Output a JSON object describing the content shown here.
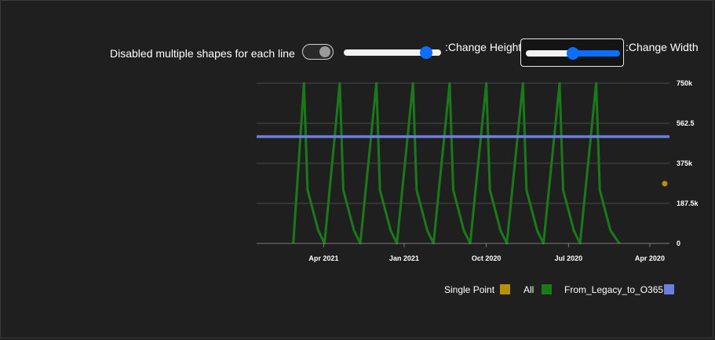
{
  "controls": {
    "toggle_label": "Disabled multiple shapes for each line",
    "height_label": ":Change Height",
    "width_label": ":Change Width",
    "height_value": 0.85,
    "width_value": 0.5
  },
  "colors": {
    "all": "#1a7a1a",
    "from_legacy": "#6c7ee1",
    "single_point": "#b8900a",
    "grid": "#4a4a4a"
  },
  "chart_data": {
    "type": "line",
    "x_axis": {
      "reversed": true,
      "range": [
        "2020-03-10",
        "2021-06-15"
      ],
      "ticks": [
        {
          "date": "2021-04-01",
          "label": "Apr 2021"
        },
        {
          "date": "2021-01-01",
          "label": "Jan 2021"
        },
        {
          "date": "2020-10-01",
          "label": "Oct 2020"
        },
        {
          "date": "2020-07-01",
          "label": "Jul 2020"
        },
        {
          "date": "2020-04-01",
          "label": "Apr 2020"
        }
      ]
    },
    "y_axis": {
      "position": "right",
      "range": [
        0,
        750000
      ],
      "ticks": [
        {
          "value": 0,
          "label": "0"
        },
        {
          "value": 187500,
          "label": "187.5k"
        },
        {
          "value": 375000,
          "label": "375k"
        },
        {
          "value": 562500,
          "label": "562.5"
        },
        {
          "value": 750000,
          "label": "750k"
        }
      ]
    },
    "grid": true,
    "legend_position": "bottom-right",
    "series": [
      {
        "name": "All",
        "points": [
          [
            "2021-05-05",
            0
          ],
          [
            "2021-04-23",
            750000
          ],
          [
            "2021-04-19",
            250000
          ],
          [
            "2021-04-07",
            60000
          ],
          [
            "2021-03-31",
            0
          ],
          [
            "2021-03-14",
            750000
          ],
          [
            "2021-03-10",
            250000
          ],
          [
            "2021-02-26",
            60000
          ],
          [
            "2021-02-19",
            0
          ],
          [
            "2021-02-01",
            750000
          ],
          [
            "2021-01-28",
            250000
          ],
          [
            "2021-01-16",
            60000
          ],
          [
            "2021-01-09",
            0
          ],
          [
            "2020-12-22",
            750000
          ],
          [
            "2020-12-18",
            250000
          ],
          [
            "2020-12-06",
            60000
          ],
          [
            "2020-11-29",
            0
          ],
          [
            "2020-11-11",
            750000
          ],
          [
            "2020-11-07",
            250000
          ],
          [
            "2020-10-26",
            60000
          ],
          [
            "2020-10-19",
            0
          ],
          [
            "2020-10-01",
            750000
          ],
          [
            "2020-09-27",
            250000
          ],
          [
            "2020-09-15",
            60000
          ],
          [
            "2020-09-08",
            0
          ],
          [
            "2020-08-21",
            750000
          ],
          [
            "2020-08-17",
            250000
          ],
          [
            "2020-08-05",
            60000
          ],
          [
            "2020-07-29",
            0
          ],
          [
            "2020-07-11",
            750000
          ],
          [
            "2020-07-07",
            250000
          ],
          [
            "2020-06-25",
            60000
          ],
          [
            "2020-06-18",
            0
          ],
          [
            "2020-05-31",
            750000
          ],
          [
            "2020-05-27",
            250000
          ],
          [
            "2020-05-15",
            60000
          ],
          [
            "2020-05-05",
            0
          ]
        ]
      },
      {
        "name": "From_Legacy_to_O365",
        "points": [
          [
            "2021-06-15",
            500000
          ],
          [
            "2020-03-10",
            500000
          ]
        ]
      },
      {
        "name": "Single Point",
        "points": [
          [
            "2020-03-01",
            280000
          ]
        ]
      }
    ],
    "legend": [
      "Single Point",
      "All",
      "From_Legacy_to_O365"
    ]
  }
}
